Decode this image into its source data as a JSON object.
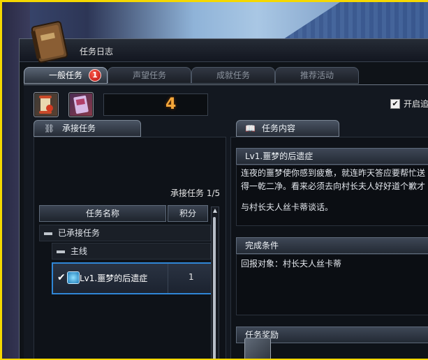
{
  "window": {
    "title": "任务日志"
  },
  "tabs": [
    {
      "label": "一般任务",
      "badge": "1",
      "active": true
    },
    {
      "label": "声望任务"
    },
    {
      "label": "成就任务"
    },
    {
      "label": "推荐活动"
    }
  ],
  "summary": {
    "count": "4"
  },
  "options": {
    "auto_label": "开启追",
    "auto_checked": true
  },
  "left": {
    "header": "承接任务",
    "accepted_count": "承接任务 1/5",
    "columns": {
      "name": "任务名称",
      "points": "积分"
    },
    "group": "已承接任务",
    "subgroup": "主线",
    "quest": {
      "name": "Lv1.噩梦的后遗症",
      "points": "1",
      "checked": true
    }
  },
  "right": {
    "header": "任务内容",
    "quest_title": "Lv1.噩梦的后遗症",
    "description_line1": "连夜的噩梦使你感到疲惫，就连昨天答应要帮忙送",
    "description_line2": "得一乾二净。看来必须去向村长夫人好好道个歉才",
    "objective": "与村长夫人丝卡蒂谈话。",
    "completion_header": "完成条件",
    "completion_text": "回报对象：村长夫人丝卡蒂",
    "rewards_header": "任务奖励"
  },
  "colors": {
    "accent": "#2f86d6",
    "count": "#f3a63a",
    "badge": "#d0201a",
    "frame": "#f5d800"
  }
}
